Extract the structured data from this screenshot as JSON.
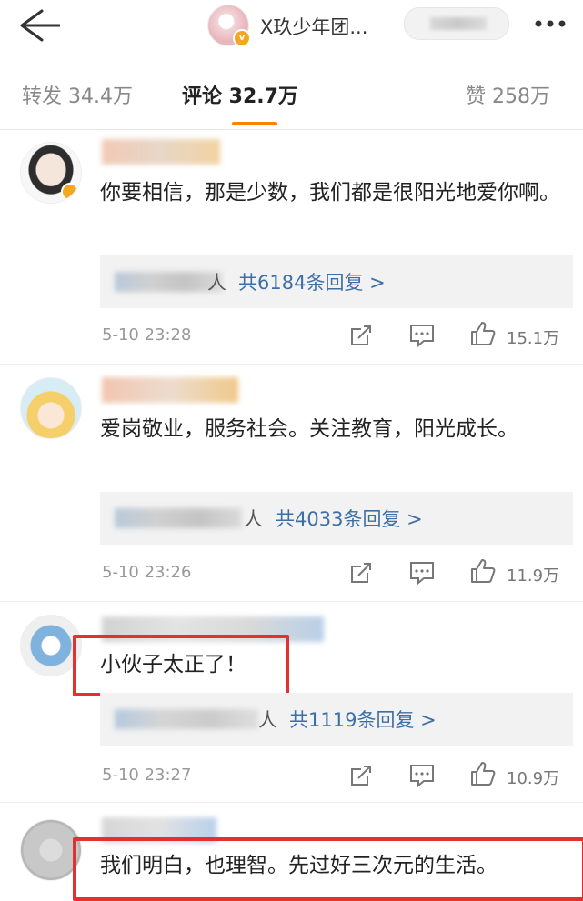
{
  "header": {
    "title": "X玖少年团...",
    "back_icon": "back-arrow-icon",
    "more_icon": "more-dots-icon"
  },
  "tabs": [
    {
      "label": "转发 34.4万",
      "active": false
    },
    {
      "label": "评论 32.7万",
      "active": true
    },
    {
      "label": "赞 258万",
      "active": false
    }
  ],
  "comments": [
    {
      "text": "你要相信，那是少数，我们都是很阳光地爱你啊。",
      "reply_people": "人",
      "reply_count": "共6184条回复 >",
      "time": "5-10 23:28",
      "likes": "15.1万"
    },
    {
      "text": "爱岗敬业，服务社会。关注教育，阳光成长。",
      "reply_people": "人",
      "reply_count": "共4033条回复 >",
      "time": "5-10 23:26",
      "likes": "11.9万"
    },
    {
      "text": "小伙子太正了！",
      "reply_people": "人",
      "reply_count": "共1119条回复 >",
      "time": "5-10 23:27",
      "likes": "10.9万"
    },
    {
      "text": "我们明白，也理智。先过好三次元的生活。"
    }
  ],
  "colors": {
    "accent": "#ff8200",
    "link": "#3d6fa6",
    "highlight_box": "#e2312f",
    "verified_badge": "#f5a623"
  }
}
